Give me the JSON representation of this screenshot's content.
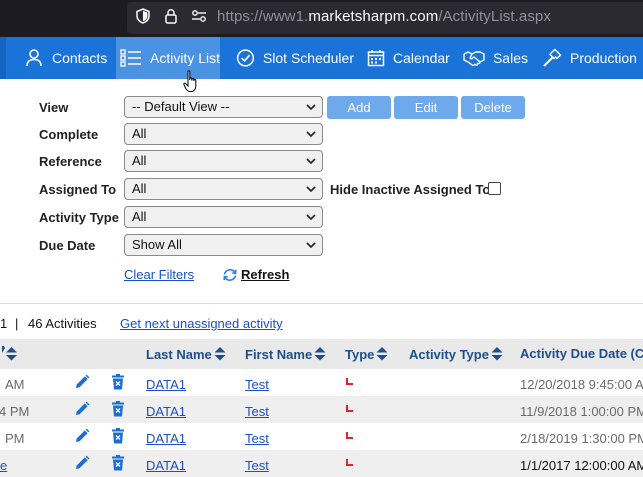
{
  "browser": {
    "url_prefix": "https://www1.",
    "url_host": "marketsharpm.com",
    "url_path": "/ActivityList.aspx"
  },
  "nav": {
    "items": [
      {
        "label": "Contacts",
        "icon": "person-icon"
      },
      {
        "label": "Activity List",
        "icon": "list-icon",
        "active": true
      },
      {
        "label": "Slot Scheduler",
        "icon": "check-circle-icon"
      },
      {
        "label": "Calendar",
        "icon": "calendar-icon"
      },
      {
        "label": "Sales",
        "icon": "handshake-icon"
      },
      {
        "label": "Production",
        "icon": "hammer-icon"
      }
    ]
  },
  "filters": {
    "view_label": "View",
    "view_value": "-- Default View --",
    "complete_label": "Complete",
    "complete_value": "All",
    "reference_label": "Reference",
    "reference_value": "All",
    "assigned_label": "Assigned To",
    "assigned_value": "All",
    "type_label": "Activity Type",
    "type_value": "All",
    "due_label": "Due Date",
    "due_value": "Show All",
    "hide_inactive_label": "Hide Inactive Assigned To",
    "hide_inactive_checked": false,
    "add_label": "Add",
    "edit_label": "Edit",
    "delete_label": "Delete",
    "clear_filters": "Clear Filters",
    "refresh": "Refresh"
  },
  "summary": {
    "page_fragment": "1",
    "separator": "|",
    "count_text": "46 Activities",
    "next_link": "Get next unassigned activity"
  },
  "table": {
    "headers": {
      "last_name": "Last Name",
      "first_name": "First Name",
      "type": "Type",
      "activity_type": "Activity Type",
      "due_date": "Activity Due Date (CD"
    },
    "rows": [
      {
        "time_fragment": "AM",
        "last_name": "DATA1",
        "first_name": "Test",
        "due": "12/20/2018 9:45:00 A",
        "due_style": "gray"
      },
      {
        "time_fragment": "4 PM",
        "last_name": "DATA1",
        "first_name": "Test",
        "due": "11/9/2018 1:00:00 PM",
        "due_style": "gray"
      },
      {
        "time_fragment": "PM",
        "last_name": "DATA1",
        "first_name": "Test",
        "due": "2/18/2019 1:30:00 PM",
        "due_style": "gray"
      },
      {
        "time_fragment": "e",
        "last_name": "DATA1",
        "first_name": "Test",
        "due": "1/1/2017 12:00:00 AM",
        "due_style": "dark"
      }
    ]
  },
  "colors": {
    "nav_bg": "#1a73d9",
    "nav_active": "#4a92e2",
    "button_bg": "#6ea9ec",
    "link": "#1a4fc8",
    "flag_red": "#e0242d"
  }
}
